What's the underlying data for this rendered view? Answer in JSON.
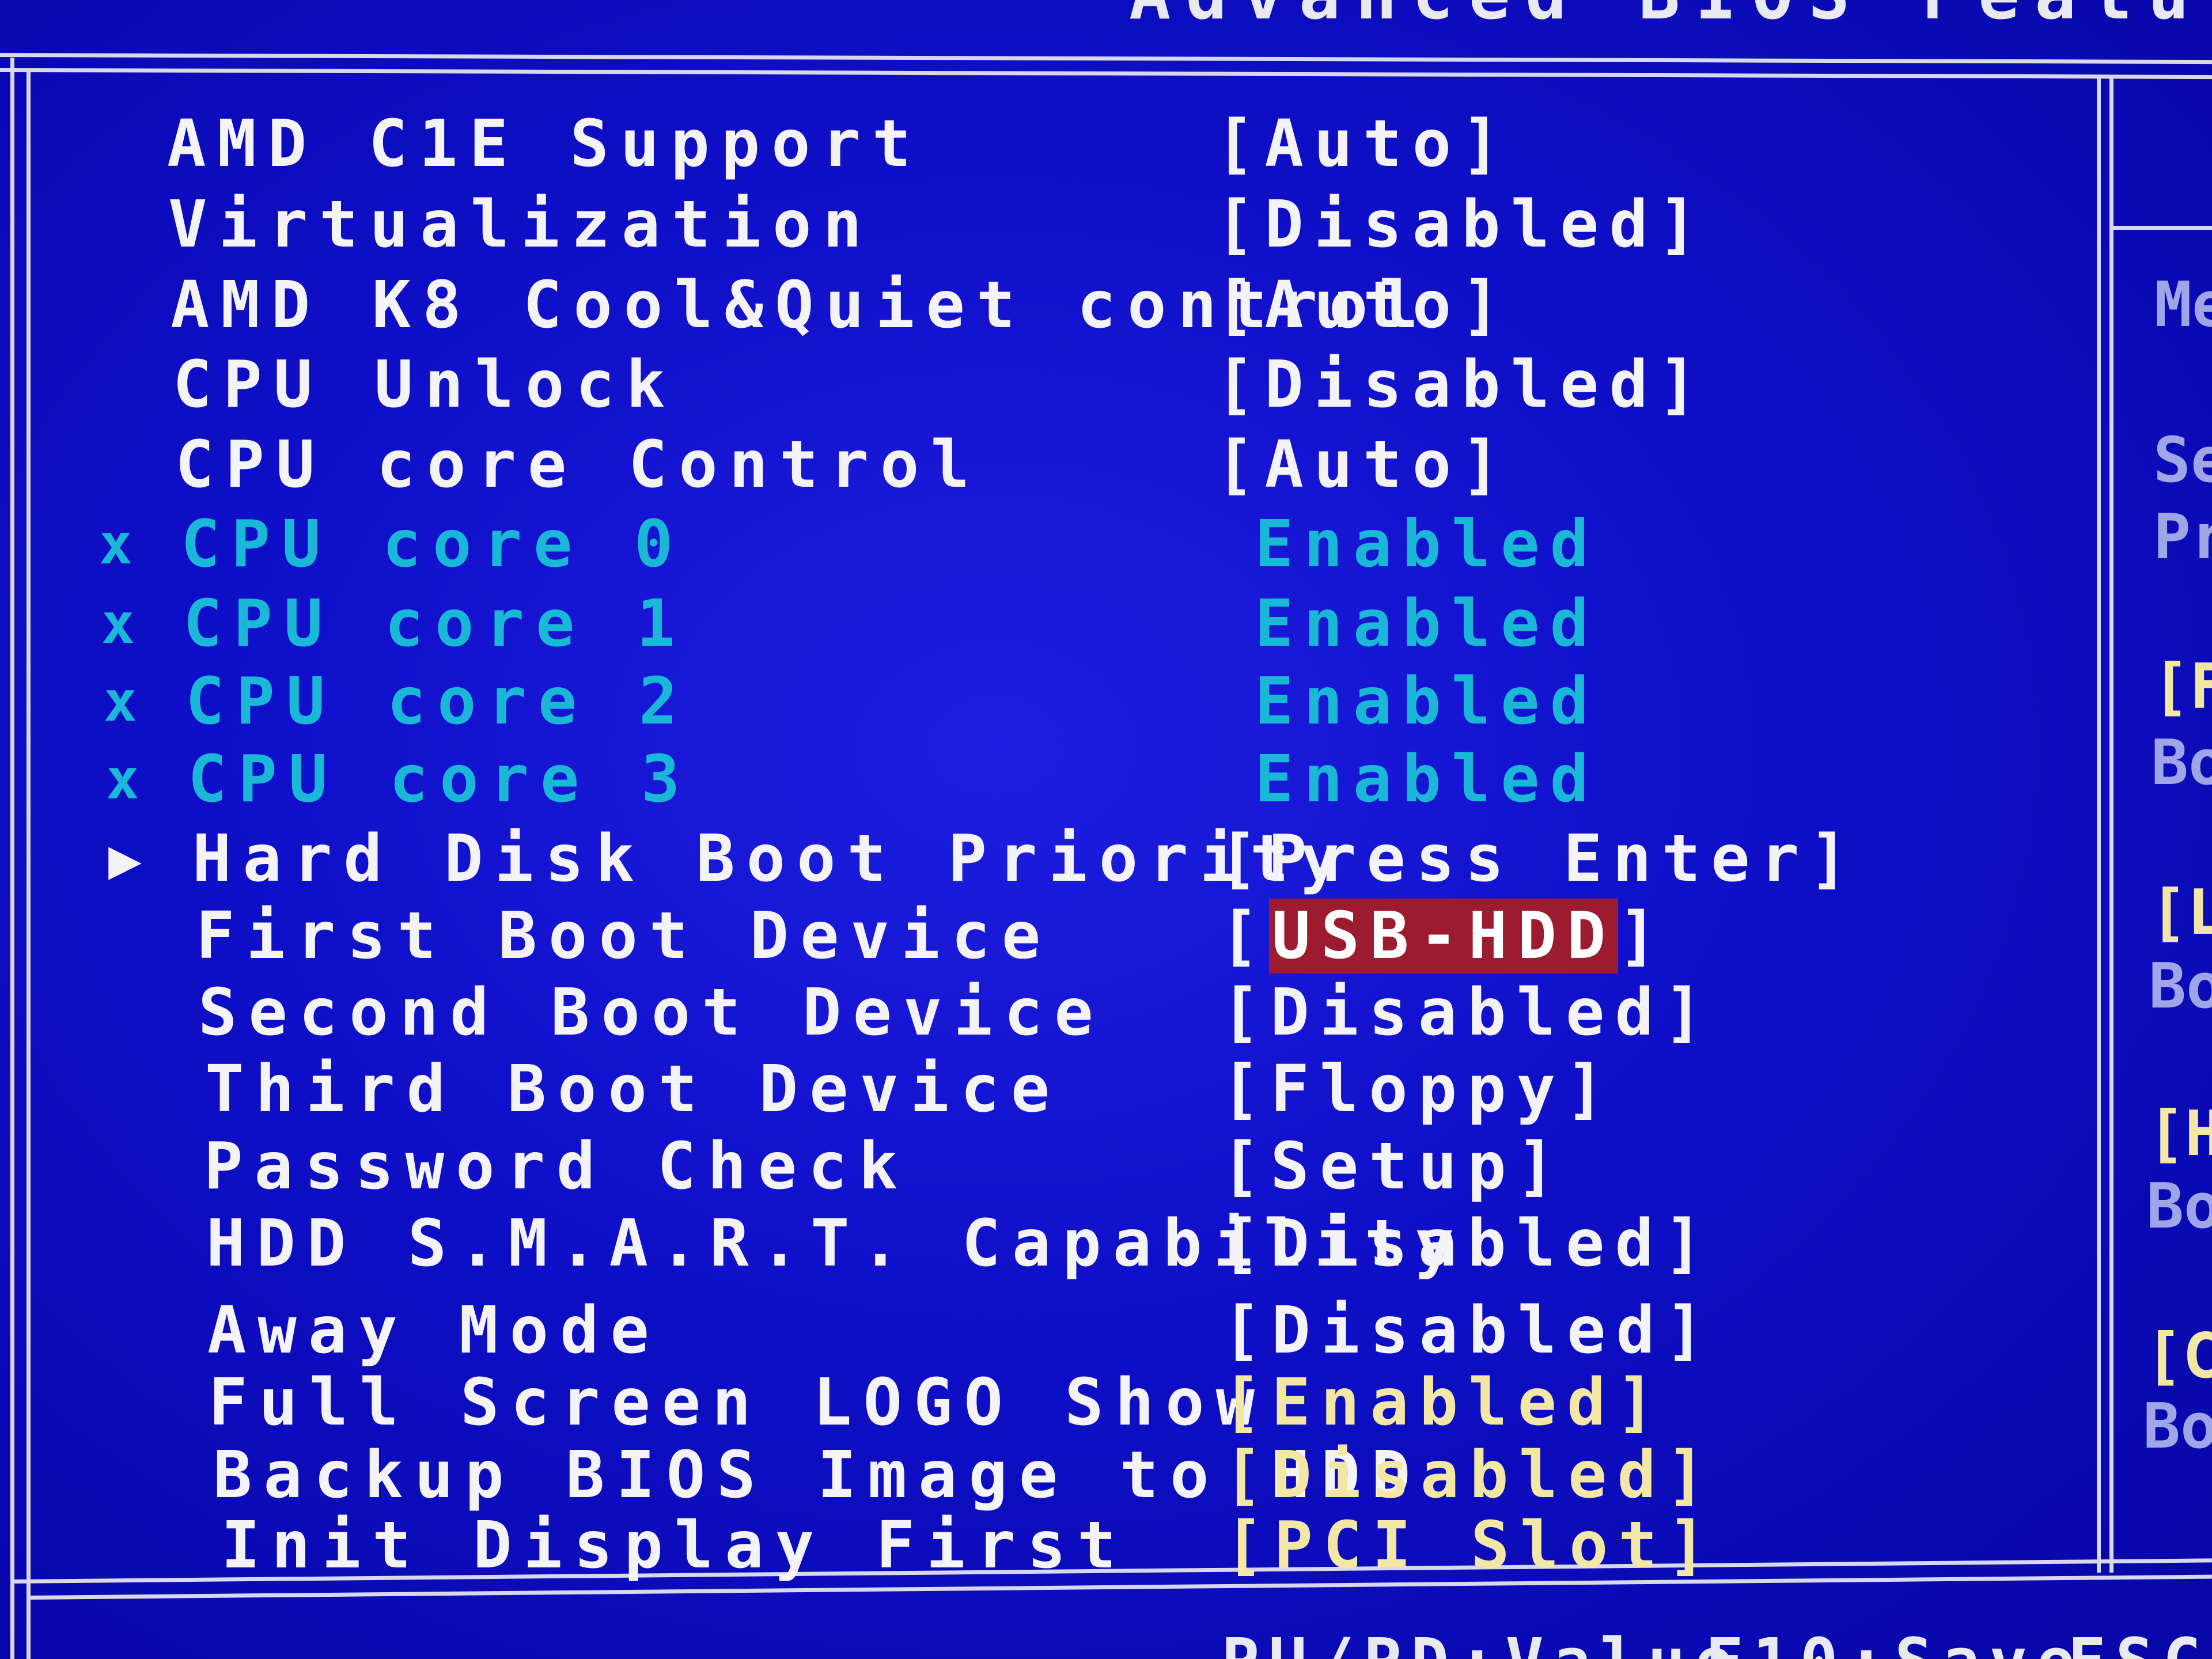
{
  "window": {
    "title": "Advanced BIOS Features"
  },
  "settings": [
    {
      "label": "AMD C1E Support",
      "value": "[Auto]",
      "state": "normal",
      "marker": ""
    },
    {
      "label": "Virtualization",
      "value": "[Disabled]",
      "state": "normal",
      "marker": ""
    },
    {
      "label": "AMD K8 Cool&Quiet control",
      "value": "[Auto]",
      "state": "normal",
      "marker": ""
    },
    {
      "label": "CPU Unlock",
      "value": "[Disabled]",
      "state": "normal",
      "marker": ""
    },
    {
      "label": "CPU core Control",
      "value": "[Auto]",
      "state": "normal",
      "marker": ""
    },
    {
      "label": "CPU core 0",
      "value": "Enabled",
      "state": "disabled",
      "marker": "x"
    },
    {
      "label": "CPU core 1",
      "value": "Enabled",
      "state": "disabled",
      "marker": "x"
    },
    {
      "label": "CPU core 2",
      "value": "Enabled",
      "state": "disabled",
      "marker": "x"
    },
    {
      "label": "CPU core 3",
      "value": "Enabled",
      "state": "disabled",
      "marker": "x"
    },
    {
      "label": "Hard Disk Boot Priority",
      "value": "[Press Enter]",
      "state": "submenu",
      "marker": "▶"
    },
    {
      "label": "First Boot Device",
      "value": "USB-HDD",
      "state": "selected",
      "marker": ""
    },
    {
      "label": "Second Boot Device",
      "value": "[Disabled]",
      "state": "normal",
      "marker": ""
    },
    {
      "label": "Third Boot Device",
      "value": "[Floppy]",
      "state": "normal",
      "marker": ""
    },
    {
      "label": "Password Check",
      "value": "[Setup]",
      "state": "normal",
      "marker": ""
    },
    {
      "label": "HDD S.M.A.R.T. Capability",
      "value": "[Disabled]",
      "state": "normal",
      "marker": ""
    },
    {
      "label": "Away Mode",
      "value": "[Disabled]",
      "state": "normal",
      "marker": ""
    },
    {
      "label": "Full Screen LOGO Show",
      "value": "[Enabled]",
      "state": "yellow",
      "marker": ""
    },
    {
      "label": "Backup BIOS Image to HDD",
      "value": "[Disabled]",
      "state": "yellow",
      "marker": ""
    },
    {
      "label": "Init Display First",
      "value": "[PCI Slot]",
      "state": "yellow",
      "marker": ""
    }
  ],
  "help_panel": {
    "lines": [
      {
        "text": "Me",
        "style": "dim"
      },
      {
        "text": "Se",
        "style": "dim"
      },
      {
        "text": "Pr",
        "style": "dim"
      },
      {
        "text": "[F",
        "style": "yellow"
      },
      {
        "text": "Bo",
        "style": "dim"
      },
      {
        "text": "[L",
        "style": "yellow"
      },
      {
        "text": "Bo",
        "style": "dim"
      },
      {
        "text": "[H",
        "style": "yellow"
      },
      {
        "text": "Bo",
        "style": "dim"
      },
      {
        "text": "[C",
        "style": "yellow"
      },
      {
        "text": "Bo",
        "style": "dim"
      }
    ]
  },
  "footer": {
    "value_hint": "PU/PD:Value",
    "save_hint": "F10:Save",
    "esc_hint": "ESC:"
  },
  "colors": {
    "background": "#1010c8",
    "text": "#f4f4f8",
    "disabled_text": "#1ab7d6",
    "yellow_text": "#f2e7a4",
    "highlight": "#9c1b2e"
  }
}
